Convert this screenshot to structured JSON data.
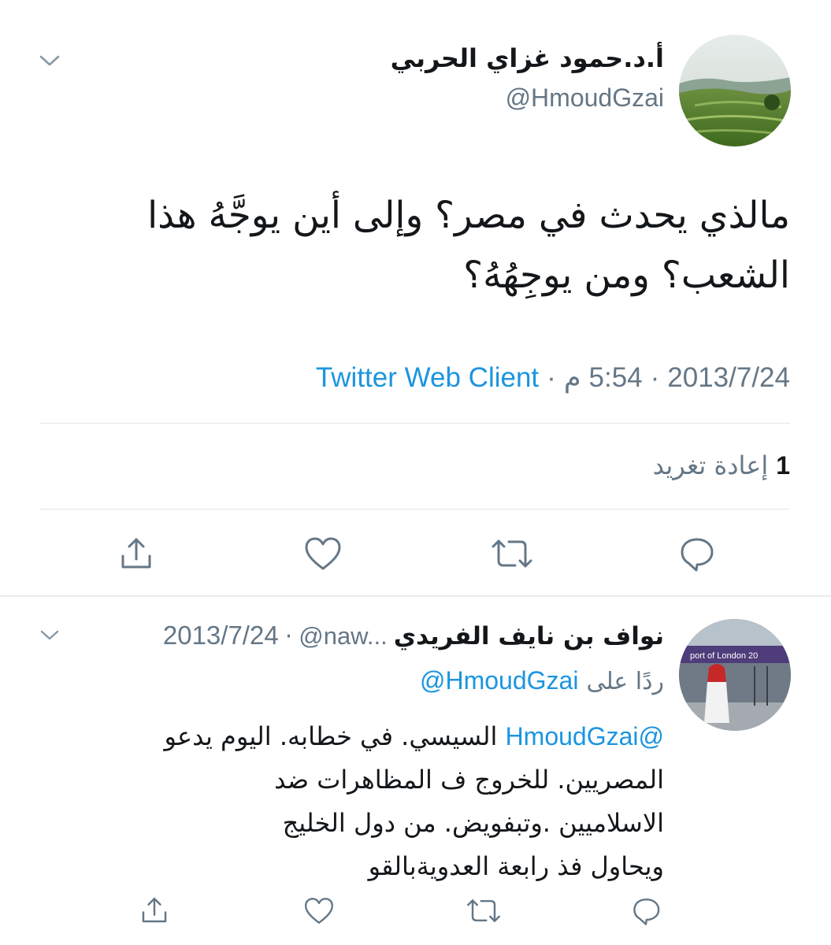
{
  "main_tweet": {
    "author_name": "أ.د.حمود غزاي الحربي",
    "handle": "@HmoudGzai",
    "text_line1": "مالذي يحدث في مصر؟ وإلى أين يوجَّهُ هذا",
    "text_line2": "الشعب؟ ومن يوجِهُهُ؟",
    "date": "2013/7/24",
    "time": "5:54",
    "time_suffix": "م",
    "separator": "·",
    "source": "Twitter Web Client",
    "retweet_count": "1",
    "retweet_label": "إعادة تغريد"
  },
  "reply_tweet": {
    "author_name": "نواف بن نايف الفريدي",
    "handle_truncated": "@naw...",
    "separator": "·",
    "date": "2013/7/24",
    "replying_to_label": "ردًا على",
    "replying_to_handle": "@HmoudGzai",
    "mention": "@HmoudGzai",
    "text_line1_rest": " السيسي. في خطابه. اليوم يدعو",
    "text_line2": "المصريين. للخروج ف المظاهرات ضد",
    "text_line3": "الاسلاميين .وتبفويض. من دول الخليج",
    "text_line4": "ويحاول فذ رابعة العدويةبالقو"
  },
  "colors": {
    "link_blue": "#1b95e0",
    "secondary_gray": "#657786",
    "divider": "#e1e8ed"
  },
  "icons": [
    "chevron-down-icon",
    "reply-icon",
    "retweet-icon",
    "like-icon",
    "share-icon"
  ]
}
